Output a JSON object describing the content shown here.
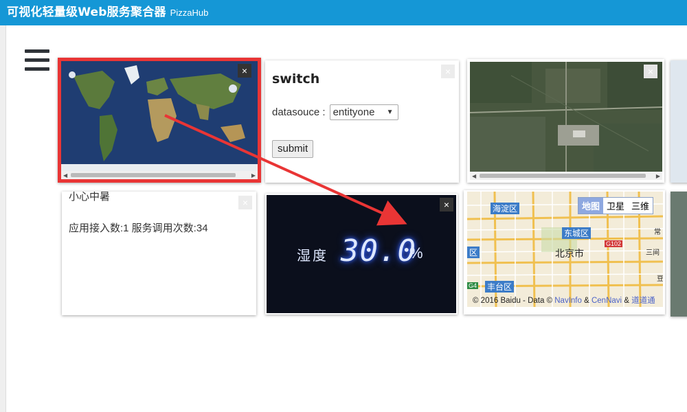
{
  "header": {
    "title": "可视化轻量级Web服务聚合器",
    "subtitle": "PizzaHub"
  },
  "close_glyph": "×",
  "switch_card": {
    "heading": "switch",
    "datasource_label": "datasouce :",
    "datasource_value": "entityone",
    "submit_label": "submit"
  },
  "text_card": {
    "line1": "小心中暑",
    "line2": "应用接入数:1 服务调用次数:34"
  },
  "humidity_card": {
    "label": "湿度",
    "value": "30.0",
    "unit": "%"
  },
  "baidu_map": {
    "tabs": [
      "地图",
      "卫星",
      "三维"
    ],
    "places": [
      "海淀区",
      "东城区",
      "北京市",
      "丰台区",
      "区",
      "三间",
      "常",
      "豆"
    ],
    "road_labels": [
      "G102",
      "G4"
    ],
    "footer": {
      "copyright": "© 2016 Baidu - Data ©",
      "navinfo": "NavInfo",
      "amp": "&",
      "cennavi": "CenNavi",
      "amp2": "&",
      "daodao": "道道通"
    }
  },
  "colors": {
    "header": "#1597d6",
    "highlight_border": "#e93535",
    "arrow": "#e93535"
  }
}
